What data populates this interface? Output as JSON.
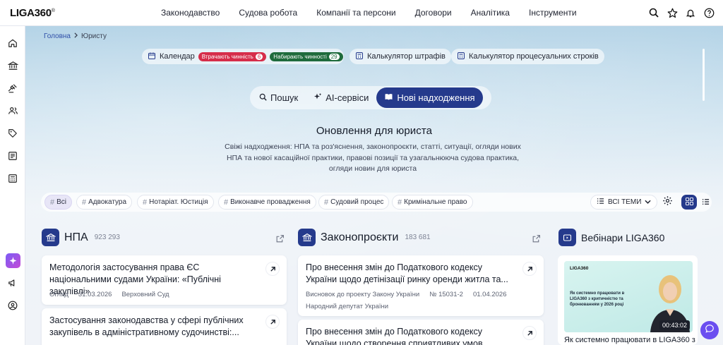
{
  "app": {
    "logo": "LIGA360",
    "logo_mark": "®"
  },
  "nav": {
    "links": [
      "Законодавство",
      "Судова робота",
      "Компанії та персони",
      "Договори",
      "Аналітика",
      "Інструменти"
    ],
    "icons": [
      "search-icon",
      "star-icon",
      "bell-icon",
      "help-icon"
    ]
  },
  "sidebar": {
    "icons": [
      "home-icon",
      "institution-icon",
      "gavel-icon",
      "people-icon",
      "tag-icon",
      "document-list-icon",
      "calculator-icon",
      "ai-sparkle-icon",
      "megaphone-icon",
      "user-circle-icon"
    ]
  },
  "breadcrumb": {
    "home": "Головна",
    "current": "Юристу"
  },
  "quick": {
    "calendar_label": "Календар",
    "badge_losing": "Втрачають чинність",
    "badge_losing_count": "6",
    "badge_gaining": "Набирають чинності",
    "badge_gaining_count": "29",
    "fines_calc": "Калькулятор штрафів",
    "deadlines_calc": "Калькулятор процесуальних строків"
  },
  "tabs": {
    "search": "Пошук",
    "ai": "AI-сервіси",
    "news": "Нові надходження"
  },
  "header": {
    "title": "Оновлення для юриста",
    "description": "Свіжі надходження: НПА та роз'яснення, законопроєкти, статті, ситуації, огляди нових НПА та нової касаційної практики, правові позиції та узагальнююча судова практика, огляди новин для юриста"
  },
  "filters": {
    "chips": [
      "Всі",
      "Адвокатура",
      "Нотаріат. Юстиція",
      "Виконавче провадження",
      "Судовий процес",
      "Кримінальне право"
    ],
    "active": "Всі",
    "topics_label": "ВСІ ТЕМИ"
  },
  "colors": {
    "accent": "#253a8c",
    "badge_red": "#d62d4a",
    "badge_green": "#1e6b3c",
    "ai_purple": "#7b5cf5"
  },
  "columns": {
    "npa": {
      "title": "НПА",
      "count": "923 293",
      "cards": [
        {
          "title": "Методологія застосування права ЄС національними судами України: «Публічні закупівлі»",
          "type": "Огляд",
          "date": "31.03.2026",
          "source": "Верховний Суд"
        },
        {
          "title": "Застосування законодавства у сфері публічних закупівель в адміністративному судочинстві:..."
        }
      ]
    },
    "bills": {
      "title": "Законопроєкти",
      "count": "183 681",
      "cards": [
        {
          "title": "Про внесення змін до Податкового кодексу України щодо детінізації ринку оренди житла та...",
          "type": "Висновок до проекту Закону України",
          "number": "№ 15031-2",
          "date": "01.04.2026",
          "author": "Народний депутат України"
        },
        {
          "title": "Про внесення змін до Податкового кодексу України щодо створення сприятливих умов надання в оренд..."
        }
      ]
    },
    "webinars": {
      "title": "Вебінари LIGA360",
      "card": {
        "promo_logo": "LIGA360",
        "promo_text": "Як системно працювати в LIGA360 з критичністю та бронюванням у 2026 році",
        "duration": "00:43:02",
        "title": "Як системно працювати в LIGA360 з"
      }
    }
  }
}
